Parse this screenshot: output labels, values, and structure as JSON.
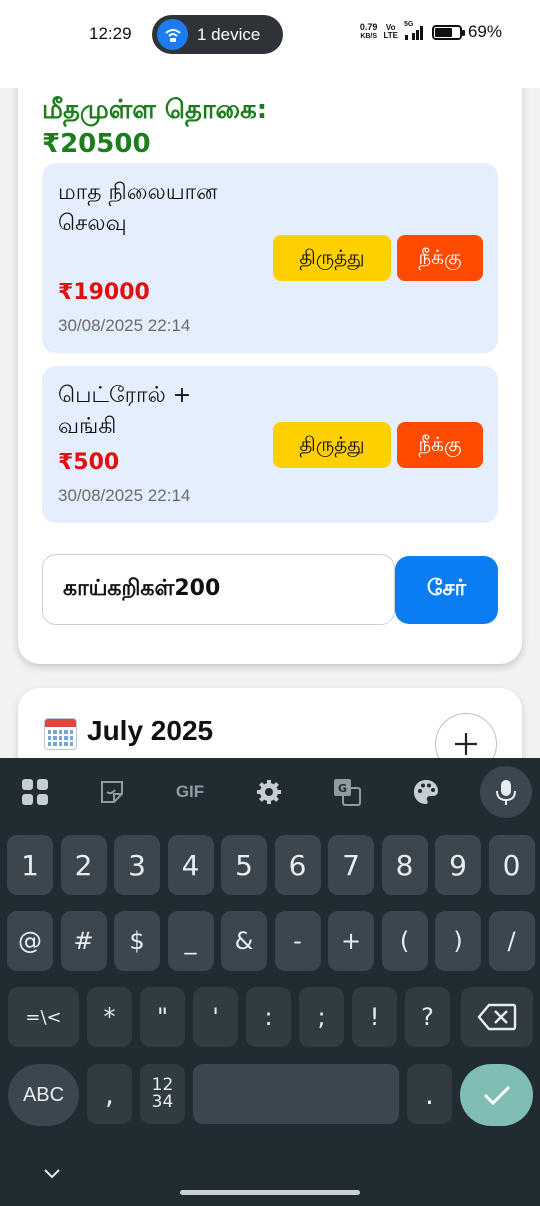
{
  "status_bar": {
    "time": "12:29",
    "pill_label": "1 device",
    "net_speed_top": "0.79",
    "net_speed_bottom": "KB/S",
    "volte_top": "Vo",
    "volte_bottom": "LTE",
    "network": "5G",
    "battery_level": 0.69,
    "battery": "69%"
  },
  "budget": {
    "remaining_label": "மீதமுள்ள தொகை:",
    "remaining_amount": "₹20500",
    "entries": [
      {
        "title": "மாத நிலையான செலவு",
        "amount": "₹19000",
        "date": "30/08/2025 22:14",
        "edit_label": "திருத்து",
        "delete_label": "நீக்கு"
      },
      {
        "title": "பெட்ரோல் + வங்கி",
        "amount": "₹500",
        "date": "30/08/2025 22:14",
        "edit_label": "திருத்து",
        "delete_label": "நீக்கு"
      }
    ],
    "input_value": "காய்கறிகள்200",
    "add_label": "சேர்"
  },
  "calendar_card": {
    "icon": "calendar-icon",
    "month": "July 2025",
    "plus_icon": "plus-icon"
  },
  "keyboard": {
    "toolbar": [
      "apps-grid-icon",
      "sticker-icon",
      "GIF",
      "settings-gear-icon",
      "translate-icon",
      "palette-icon",
      "mic-icon"
    ],
    "gif_label": "GIF",
    "row1": [
      "1",
      "2",
      "3",
      "4",
      "5",
      "6",
      "7",
      "8",
      "9",
      "0"
    ],
    "row2": [
      "@",
      "#",
      "$",
      "_",
      "&",
      "-",
      "+",
      "(",
      ")",
      "/"
    ],
    "row3": [
      "=\\<",
      "*",
      "\"",
      "'",
      ":",
      ";",
      "!",
      "?"
    ],
    "abc_label": "ABC",
    "comma": ",",
    "numpad_top": "12",
    "numpad_bottom": "34",
    "period": ".",
    "accent": "#7fbdb5"
  }
}
